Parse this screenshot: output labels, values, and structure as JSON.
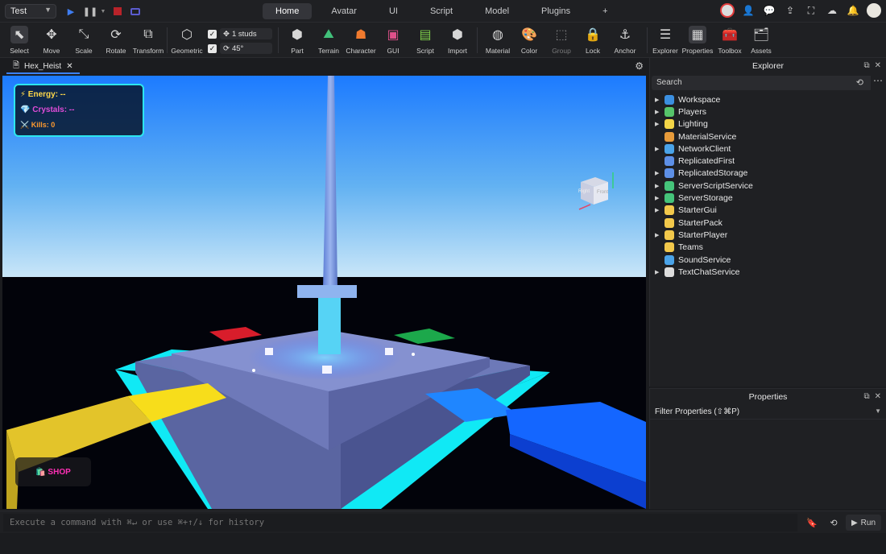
{
  "topbar": {
    "mode": "Test",
    "tabs": [
      {
        "label": "Home",
        "active": true
      },
      {
        "label": "Avatar",
        "active": false
      },
      {
        "label": "UI",
        "active": false
      },
      {
        "label": "Script",
        "active": false
      },
      {
        "label": "Model",
        "active": false
      },
      {
        "label": "Plugins",
        "active": false
      },
      {
        "label": "+",
        "active": false
      }
    ]
  },
  "ribbon": {
    "tools": {
      "select": "Select",
      "move": "Move",
      "scale": "Scale",
      "rotate": "Rotate",
      "transform": "Transform",
      "geometric": "Geometric",
      "part": "Part",
      "terrain": "Terrain",
      "character": "Character",
      "gui": "GUI",
      "script": "Script",
      "import": "Import",
      "material": "Material",
      "color": "Color",
      "group": "Group",
      "lock": "Lock",
      "anchor": "Anchor",
      "explorer": "Explorer",
      "properties": "Properties",
      "toolbox": "Toolbox",
      "assets": "Assets"
    },
    "move_snap": "1 studs",
    "rotate_snap": "45°"
  },
  "document": {
    "tab": "Hex_Heist"
  },
  "viewport": {
    "hud": {
      "energy": "⚡ Energy: --",
      "crystals": "💎 Crystals: --",
      "kills": "⚔️ Kills: 0"
    },
    "shop": "🛍️ SHOP",
    "view_cube": {
      "left": "Right",
      "front": "Front"
    }
  },
  "explorer": {
    "title": "Explorer",
    "search_placeholder": "Search",
    "items": [
      {
        "label": "Workspace",
        "expandable": true,
        "color": "#3b8fe0"
      },
      {
        "label": "Players",
        "expandable": true,
        "color": "#56c46a"
      },
      {
        "label": "Lighting",
        "expandable": true,
        "color": "#f3d547"
      },
      {
        "label": "MaterialService",
        "expandable": false,
        "color": "#e79b3a"
      },
      {
        "label": "NetworkClient",
        "expandable": true,
        "color": "#4aa3e8"
      },
      {
        "label": "ReplicatedFirst",
        "expandable": false,
        "color": "#5d8fe6"
      },
      {
        "label": "ReplicatedStorage",
        "expandable": true,
        "color": "#5d8fe6"
      },
      {
        "label": "ServerScriptService",
        "expandable": true,
        "color": "#45c47a"
      },
      {
        "label": "ServerStorage",
        "expandable": true,
        "color": "#45c47a"
      },
      {
        "label": "StarterGui",
        "expandable": true,
        "color": "#f2c84b"
      },
      {
        "label": "StarterPack",
        "expandable": false,
        "color": "#f2c84b"
      },
      {
        "label": "StarterPlayer",
        "expandable": true,
        "color": "#f2c84b"
      },
      {
        "label": "Teams",
        "expandable": false,
        "color": "#f2c84b"
      },
      {
        "label": "SoundService",
        "expandable": false,
        "color": "#4aa3e8"
      },
      {
        "label": "TextChatService",
        "expandable": true,
        "color": "#dcdcdc"
      }
    ]
  },
  "properties": {
    "title": "Properties",
    "filter_placeholder": "Filter Properties (⇧⌘P)"
  },
  "command": {
    "placeholder": "Execute a command with ⌘↵ or use ⌘+↑/↓ for history",
    "run": "Run"
  }
}
